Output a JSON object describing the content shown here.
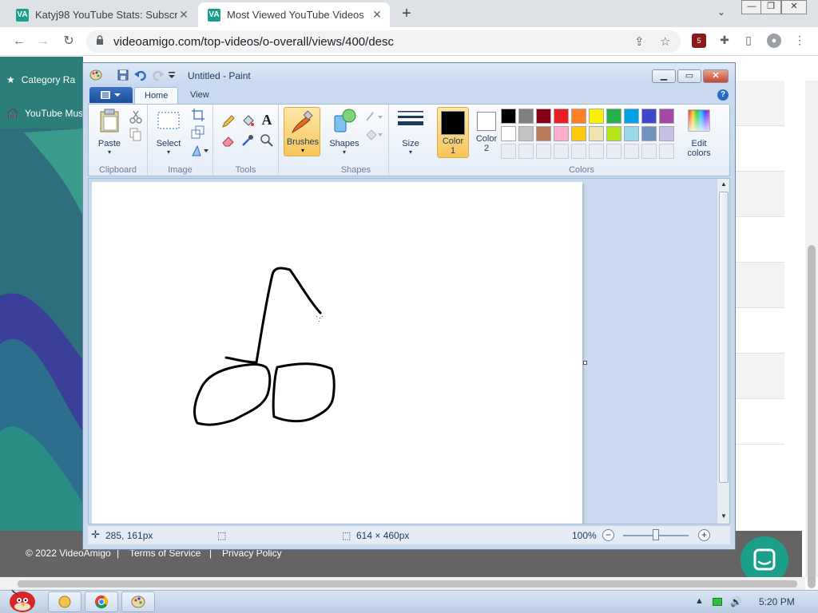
{
  "browser": {
    "tabs": [
      {
        "title": "Katyj98 YouTube Stats: Subscri",
        "favicon": "VA",
        "active": false
      },
      {
        "title": "Most Viewed YouTube Videos",
        "favicon": "VA",
        "active": true
      }
    ],
    "url": "videoamigo.com/top-videos/o-overall/views/400/desc"
  },
  "page": {
    "nav_item_1": "Category Ra",
    "nav_item_2": "YouTube Mus",
    "footer": {
      "copyright": "© 2022 VideoAmigo",
      "terms": "Terms of Service",
      "privacy": "Privacy Policy",
      "sep": "|"
    }
  },
  "paint": {
    "title": "Untitled - Paint",
    "tabs": {
      "home": "Home",
      "view": "View"
    },
    "groups": {
      "clipboard": "Clipboard",
      "image": "Image",
      "tools": "Tools",
      "shapes": "Shapes",
      "colors": "Colors"
    },
    "buttons": {
      "paste": "Paste",
      "select": "Select",
      "brushes": "Brushes",
      "shapes": "Shapes",
      "size": "Size",
      "color1_a": "Color",
      "color1_b": "1",
      "color2_a": "Color",
      "color2_b": "2",
      "edit_colors_a": "Edit",
      "edit_colors_b": "colors"
    },
    "color1": "#000000",
    "color2": "#ffffff",
    "palette_row1": [
      "#000000",
      "#7f7f7f",
      "#880015",
      "#ed1c24",
      "#ff7f27",
      "#fff200",
      "#22b14c",
      "#00a2e8",
      "#3f48cc",
      "#a349a4"
    ],
    "palette_row2": [
      "#ffffff",
      "#c3c3c3",
      "#b97a57",
      "#ffaec9",
      "#ffc90e",
      "#efe4b0",
      "#b5e61d",
      "#99d9ea",
      "#7092be",
      "#c8bfe7"
    ],
    "status": {
      "cursor_pos": "285, 161px",
      "image_size": "614 × 460px",
      "zoom": "100%"
    }
  },
  "taskbar": {
    "clock": "5:20 PM"
  },
  "colors": {
    "accent": "#1b9e8a",
    "footer": "#646464"
  }
}
